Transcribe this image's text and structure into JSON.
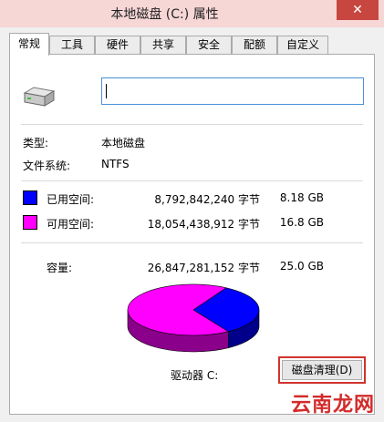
{
  "window": {
    "title": "本地磁盘 (C:) 属性",
    "close_label": "✕"
  },
  "tabs": [
    {
      "label": "常规",
      "active": true
    },
    {
      "label": "工具"
    },
    {
      "label": "硬件"
    },
    {
      "label": "共享"
    },
    {
      "label": "安全"
    },
    {
      "label": "配额"
    },
    {
      "label": "自定义"
    }
  ],
  "general": {
    "icon": "drive-icon",
    "name_value": "",
    "type_label": "类型:",
    "type_value": "本地磁盘",
    "fs_label": "文件系统:",
    "fs_value": "NTFS",
    "used": {
      "label": "已用空间:",
      "bytes": "8,792,842,240 字节",
      "size": "8.18 GB",
      "color": "#0000ff"
    },
    "free": {
      "label": "可用空间:",
      "bytes": "18,054,438,912 字节",
      "size": "16.8 GB",
      "color": "#ff00ff"
    },
    "capacity": {
      "label": "容量:",
      "bytes": "26,847,281,152 字节",
      "size": "25.0 GB"
    },
    "drive_label": "驱动器 C:",
    "cleanup_button": "磁盘清理(D)"
  },
  "chart_data": {
    "type": "pie",
    "categories": [
      "已用空间",
      "可用空间"
    ],
    "values": [
      8792842240,
      18054438912
    ],
    "colors": [
      "#0000ff",
      "#ff00ff"
    ]
  },
  "watermark": "云南龙网"
}
